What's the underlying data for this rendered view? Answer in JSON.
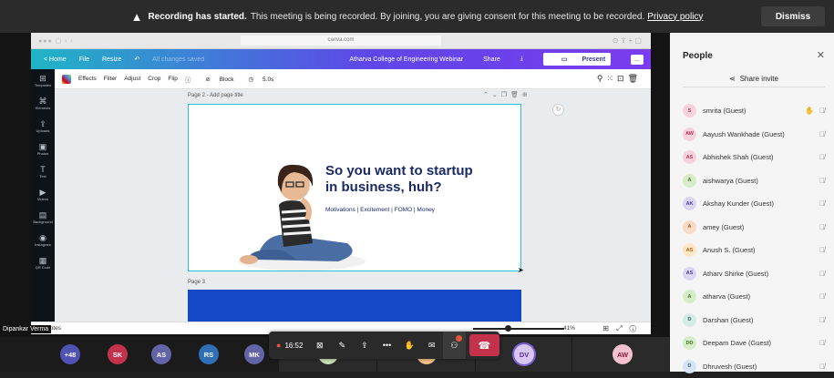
{
  "banner": {
    "bold": "Recording has started.",
    "text": "This meeting is being recorded. By joining, you are giving consent for this meeting to be recorded.",
    "link": "Privacy policy",
    "dismiss": "Dismiss"
  },
  "browser": {
    "url": "canva.com"
  },
  "canva_bar": {
    "home": "< Home",
    "file": "File",
    "resize": "Resize",
    "saved": "All changes saved",
    "doc_title": "Atharva College of Engineering Webinar",
    "share": "Share",
    "present": "Present",
    "more": "..."
  },
  "canva_toolbar": {
    "effects": "Effects",
    "filter": "Filter",
    "adjust": "Adjust",
    "crop": "Crop",
    "flip": "Flip",
    "block": "Block",
    "duration": "5.0s"
  },
  "canva_sidebar": {
    "items": [
      {
        "icon": "⊞",
        "label": "Templates"
      },
      {
        "icon": "⌘",
        "label": "Elements"
      },
      {
        "icon": "⇪",
        "label": "Uploads"
      },
      {
        "icon": "▣",
        "label": "Photos"
      },
      {
        "icon": "T",
        "label": "Text"
      },
      {
        "icon": "▶",
        "label": "Videos"
      },
      {
        "icon": "▤",
        "label": "Background"
      },
      {
        "icon": "◉",
        "label": "Instagram"
      },
      {
        "icon": "▦",
        "label": "QR Code"
      }
    ]
  },
  "slide": {
    "page_label": "Page 2 - Add page title",
    "headline_1": "So you want to startup",
    "headline_2": "in business, huh?",
    "subtitle": "Motivations | Excitement | FOMO | Money",
    "page3_label": "Page 3"
  },
  "notes": {
    "label": "Notes",
    "zoom": "41%",
    "zoom_fraction": 0.41
  },
  "presenter_name": "Dipankar Verma",
  "meeting_controls": {
    "timer": "16:52"
  },
  "bottom_avatars": [
    {
      "initials": "+48",
      "color": "#4f52b2"
    },
    {
      "initials": "SK",
      "color": "#c4314b"
    },
    {
      "initials": "AS",
      "color": "#6264a7"
    },
    {
      "initials": "RS",
      "color": "#2f6fb5"
    },
    {
      "initials": "MK",
      "color": "#6264a7"
    }
  ],
  "tile_avatars": [
    {
      "initials": "A",
      "color": "#cde3b5",
      "fg": "#2a5a12"
    },
    {
      "initials": "S",
      "color": "#f7c38a",
      "fg": "#7a3b00"
    },
    {
      "initials": "DV",
      "color": "#d8c6f0",
      "fg": "#5a2d96"
    },
    {
      "initials": "AW",
      "color": "#f3c2ce",
      "fg": "#8c1c3a"
    }
  ],
  "people_panel": {
    "title": "People",
    "share_invite": "Share invite",
    "people": [
      {
        "initials": "S",
        "name": "smrita (Guest)",
        "bg": "#f6d3dc",
        "fg": "#b2344f",
        "hand": true
      },
      {
        "initials": "AW",
        "name": "Aayush Wankhade (Guest)",
        "bg": "#f6d3dc",
        "fg": "#b2344f",
        "hand": false
      },
      {
        "initials": "AS",
        "name": "Abhishek Shah (Guest)",
        "bg": "#f6d3dc",
        "fg": "#b2344f",
        "hand": false
      },
      {
        "initials": "A",
        "name": "aishwarya (Guest)",
        "bg": "#d7ecc8",
        "fg": "#3a7a1a",
        "hand": false
      },
      {
        "initials": "AK",
        "name": "Akshay Kunder (Guest)",
        "bg": "#dcd6f3",
        "fg": "#4b3a96",
        "hand": false
      },
      {
        "initials": "A",
        "name": "amey (Guest)",
        "bg": "#f9dcc7",
        "fg": "#b0541a",
        "hand": false
      },
      {
        "initials": "AS",
        "name": "Anush S. (Guest)",
        "bg": "#fce6c4",
        "fg": "#b0621a",
        "hand": false
      },
      {
        "initials": "AS",
        "name": "Atharv Shirke (Guest)",
        "bg": "#dcd6f3",
        "fg": "#4b3a96",
        "hand": false
      },
      {
        "initials": "A",
        "name": "atharva (Guest)",
        "bg": "#d7ecc8",
        "fg": "#3a7a1a",
        "hand": false
      },
      {
        "initials": "D",
        "name": "Darshan (Guest)",
        "bg": "#d5ebe6",
        "fg": "#1c6b5c",
        "hand": false
      },
      {
        "initials": "DD",
        "name": "Deepam Dave (Guest)",
        "bg": "#d7ecc8",
        "fg": "#3a7a1a",
        "hand": false
      },
      {
        "initials": "D",
        "name": "Dhruvesh (Guest)",
        "bg": "#d6e4f6",
        "fg": "#2b5ea8",
        "hand": false
      }
    ]
  }
}
